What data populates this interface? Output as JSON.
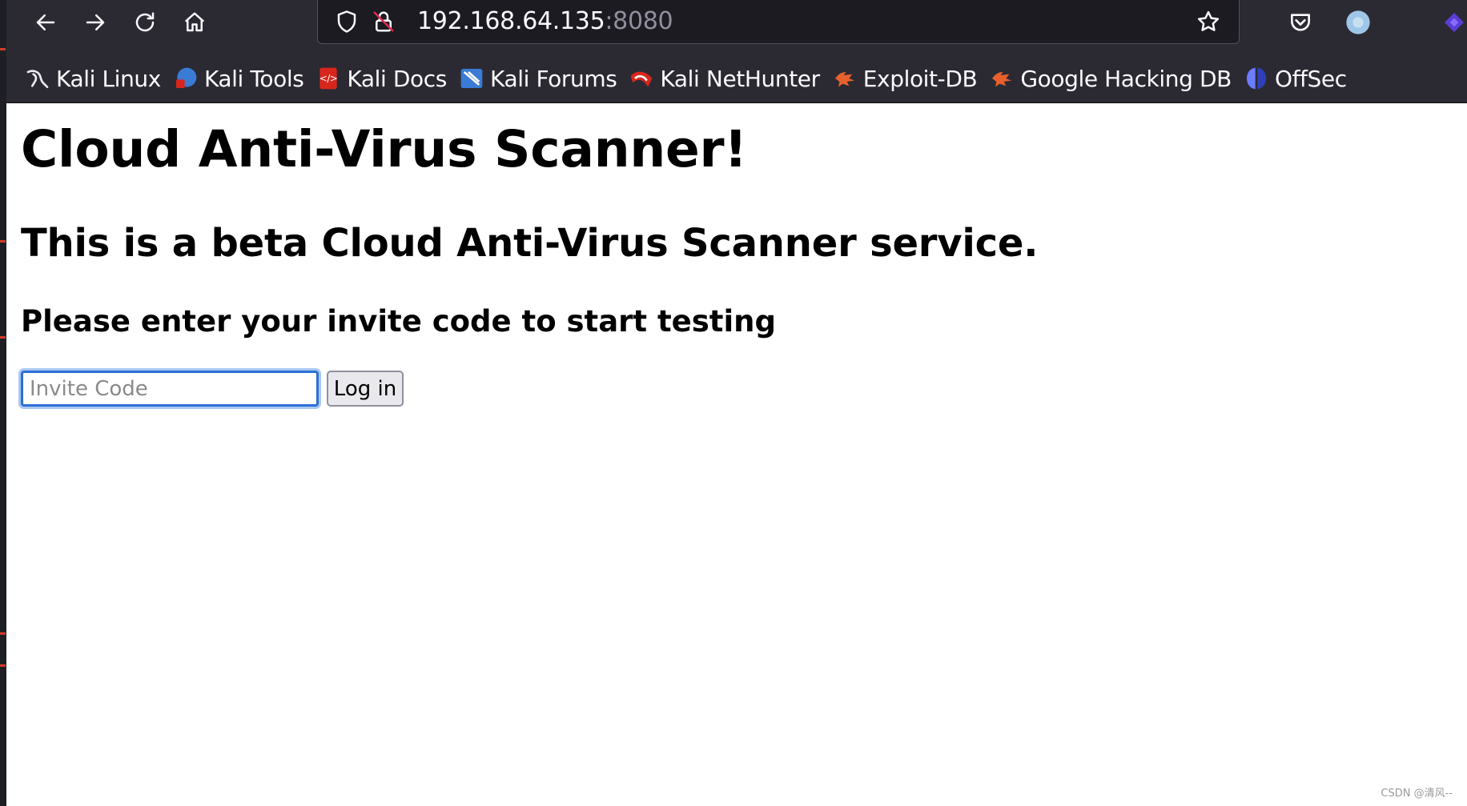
{
  "browser": {
    "url_host": "192.168.64.135",
    "url_port": ":8080",
    "nav_icons": [
      "back-arrow-icon",
      "forward-arrow-icon",
      "reload-icon",
      "home-icon"
    ],
    "url_icons": [
      "tracking-shield-icon",
      "insecure-lock-icon"
    ],
    "right_icons": [
      "bookmark-star-icon",
      "pocket-icon",
      "account-icon",
      "extension-icon"
    ],
    "bookmarks": [
      {
        "label": "Kali Linux",
        "icon": "kali-dragon-icon"
      },
      {
        "label": "Kali Tools",
        "icon": "kali-tools-icon"
      },
      {
        "label": "Kali Docs",
        "icon": "kali-docs-icon"
      },
      {
        "label": "Kali Forums",
        "icon": "kali-forums-icon"
      },
      {
        "label": "Kali NetHunter",
        "icon": "nethunter-icon"
      },
      {
        "label": "Exploit-DB",
        "icon": "exploit-db-icon"
      },
      {
        "label": "Google Hacking DB",
        "icon": "ghdb-icon"
      },
      {
        "label": "OffSec",
        "icon": "offsec-icon"
      }
    ]
  },
  "page": {
    "title": "Cloud Anti-Virus Scanner!",
    "subtitle": "This is a beta Cloud Anti-Virus Scanner service.",
    "prompt": "Please enter your invite code to start testing",
    "invite_placeholder": "Invite Code",
    "invite_value": "",
    "login_label": "Log in"
  },
  "watermark": "CSDN @清风--",
  "colors": {
    "toolbar_bg": "#2b2a33",
    "urlbar_bg": "#1c1b22",
    "focus_ring": "#2b6fd6",
    "kali_blue": "#3a7bd5",
    "kali_red": "#d9261c",
    "exploit_orange": "#e8602c",
    "offsec_blue": "#6b7cff"
  }
}
